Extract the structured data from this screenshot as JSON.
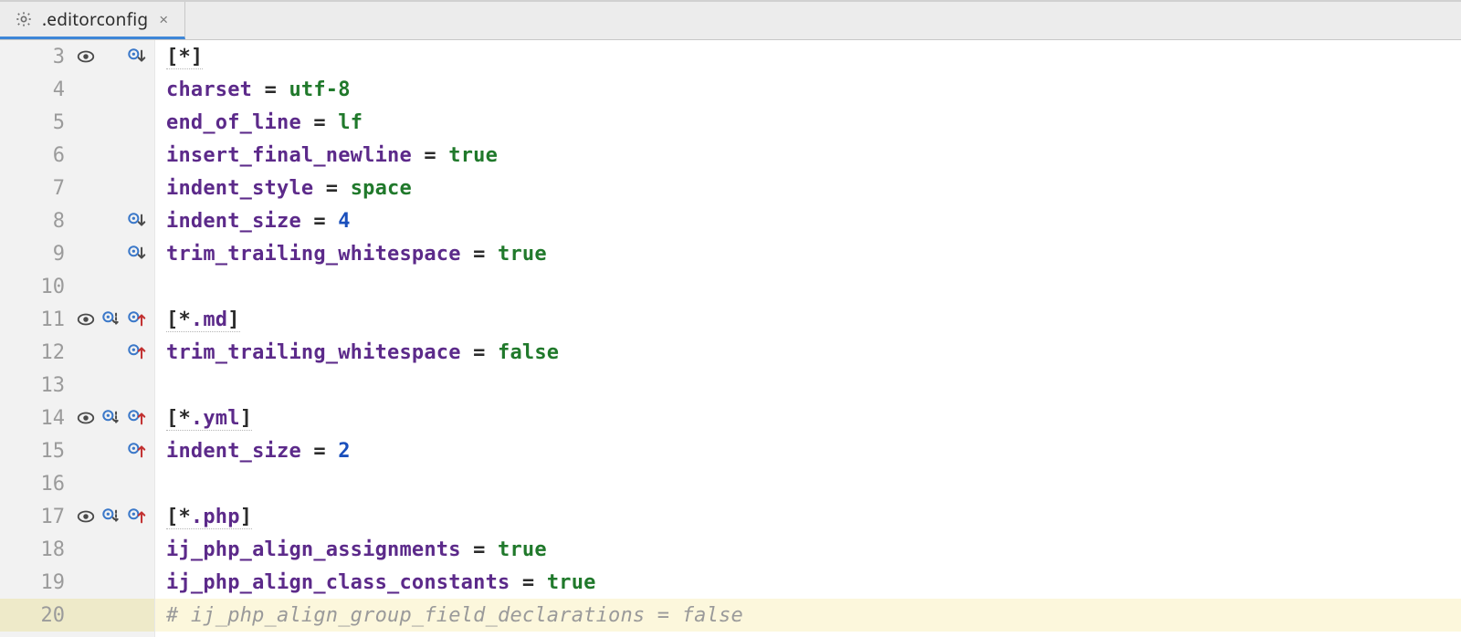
{
  "tab": {
    "filename": ".editorconfig",
    "close": "×"
  },
  "lines": [
    {
      "n": 3,
      "markers": [
        "eye",
        "ov-down"
      ],
      "type": "section",
      "text": "*"
    },
    {
      "n": 4,
      "markers": [],
      "type": "kv",
      "key": "charset",
      "value": "utf-8",
      "vtype": "val"
    },
    {
      "n": 5,
      "markers": [],
      "type": "kv",
      "key": "end_of_line",
      "value": "lf",
      "vtype": "val"
    },
    {
      "n": 6,
      "markers": [],
      "type": "kv",
      "key": "insert_final_newline",
      "value": "true",
      "vtype": "val"
    },
    {
      "n": 7,
      "markers": [],
      "type": "kv",
      "key": "indent_style",
      "value": "space",
      "vtype": "val"
    },
    {
      "n": 8,
      "markers": [
        "ov-down"
      ],
      "type": "kv",
      "key": "indent_size",
      "value": "4",
      "vtype": "num"
    },
    {
      "n": 9,
      "markers": [
        "ov-down"
      ],
      "type": "kv",
      "key": "trim_trailing_whitespace",
      "value": "true",
      "vtype": "val"
    },
    {
      "n": 10,
      "markers": [],
      "type": "blank"
    },
    {
      "n": 11,
      "markers": [
        "eye",
        "ov-down-dot",
        "ov-up"
      ],
      "type": "section",
      "text": "*.md"
    },
    {
      "n": 12,
      "markers": [
        "ov-up"
      ],
      "type": "kv",
      "key": "trim_trailing_whitespace",
      "value": "false",
      "vtype": "val"
    },
    {
      "n": 13,
      "markers": [],
      "type": "blank"
    },
    {
      "n": 14,
      "markers": [
        "eye",
        "ov-down-dot",
        "ov-up"
      ],
      "type": "section",
      "text": "*.yml"
    },
    {
      "n": 15,
      "markers": [
        "ov-up"
      ],
      "type": "kv",
      "key": "indent_size",
      "value": "2",
      "vtype": "num"
    },
    {
      "n": 16,
      "markers": [],
      "type": "blank"
    },
    {
      "n": 17,
      "markers": [
        "eye",
        "ov-down-dot",
        "ov-up"
      ],
      "type": "section",
      "text": "*.php"
    },
    {
      "n": 18,
      "markers": [],
      "type": "kv",
      "key": "ij_php_align_assignments",
      "value": "true",
      "vtype": "val"
    },
    {
      "n": 19,
      "markers": [],
      "type": "kv",
      "key": "ij_php_align_class_constants",
      "value": "true",
      "vtype": "val"
    },
    {
      "n": 20,
      "markers": [],
      "type": "comment",
      "text": "# ij_php_align_group_field_declarations = false",
      "highlight": true
    }
  ],
  "icons": {
    "eye": "eye-icon",
    "ov-down": "override-down-icon",
    "ov-down-dot": "override-down-dotted-icon",
    "ov-up": "override-up-icon"
  }
}
